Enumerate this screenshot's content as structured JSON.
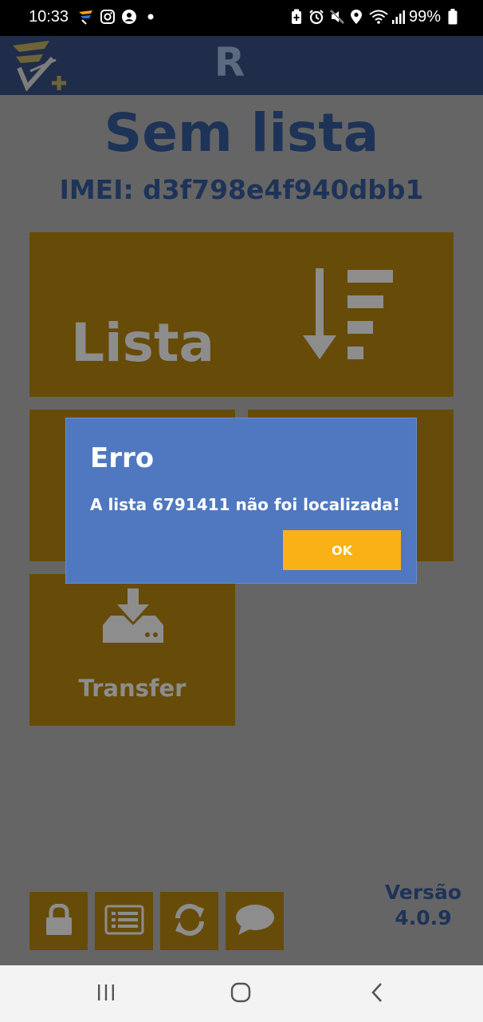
{
  "status_bar": {
    "time": "10:33",
    "battery": "99%",
    "icons": [
      "app-logo-icon",
      "instagram-icon",
      "account-icon",
      "dot-icon",
      "battery-saver-icon",
      "alarm-icon",
      "mute-icon",
      "location-icon",
      "wifi-icon",
      "signal-icon",
      "battery-icon"
    ]
  },
  "app_bar": {
    "title": "R",
    "logo": "app-logo-icon"
  },
  "main": {
    "heading": "Sem lista",
    "imei": "IMEI: d3f798e4f940dbb1",
    "tiles": {
      "lista": {
        "label": "Lista",
        "icon": "sort-descending-icon"
      },
      "transfer": {
        "label": "Transfer",
        "icon": "download-drive-icon"
      }
    },
    "bottom_buttons": [
      "lock-icon",
      "list-icon",
      "sync-icon",
      "chat-icon"
    ],
    "version_label": "Versão",
    "version_number": "4.0.9"
  },
  "dialog": {
    "title": "Erro",
    "message": "A lista 6791411 não foi localizada!",
    "ok_label": "OK"
  },
  "colors": {
    "overlay_bg": "#656565",
    "header_bg": "#1f2d4a",
    "tile_bg": "#664c08",
    "dialog_bg": "#4f78c0",
    "button_accent": "#f9b115",
    "text_dark_blue": "#1e3358"
  }
}
